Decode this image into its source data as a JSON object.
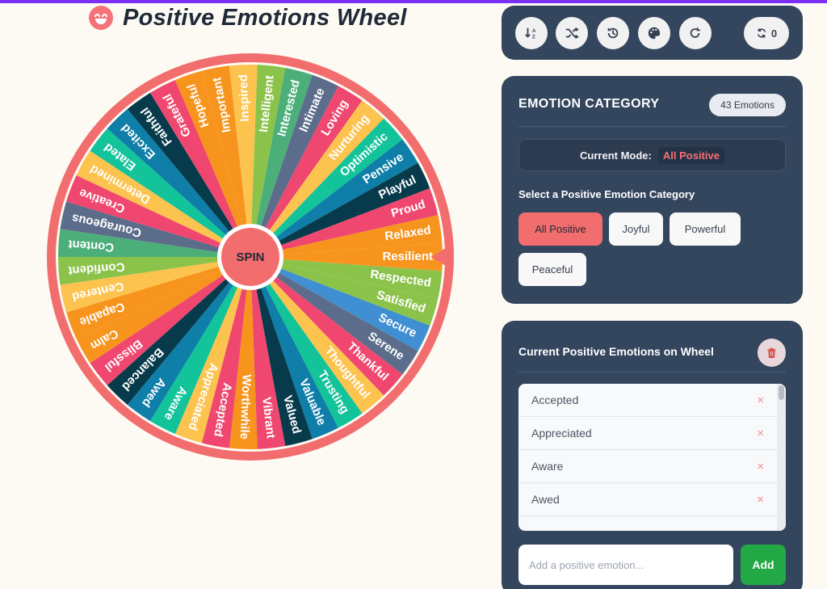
{
  "header": {
    "title": "Positive Emotions Wheel",
    "emoji_icon": "smiley-icon"
  },
  "wheel": {
    "spin_label": "SPIN",
    "rim_color": "#f26d6d",
    "segments": [
      "Resilient",
      "Respected",
      "Satisfied",
      "Secure",
      "Serene",
      "Thankful",
      "Thoughtful",
      "Trusting",
      "Valuable",
      "Valued",
      "Vibrant",
      "Worthwhile",
      "Accepted",
      "Appreciated",
      "Aware",
      "Awed",
      "Balanced",
      "Blissful",
      "Calm",
      "Capable",
      "Centered",
      "Confident",
      "Content",
      "Courageous",
      "Creative",
      "Determined",
      "Elated",
      "Excited",
      "Faithful",
      "Grateful",
      "Hopeful",
      "Important",
      "Inspired",
      "Intelligent",
      "Interested",
      "Intimate",
      "Loving",
      "Nurturing",
      "Optimistic",
      "Pensive",
      "Playful",
      "Proud",
      "Relaxed"
    ],
    "colors": [
      "#f7941d",
      "#8bc34a",
      "#8bc34a",
      "#3f8fd2",
      "#5b6d8a",
      "#ef476f",
      "#fcc34f",
      "#13c39a",
      "#0f7ea8",
      "#073b4c",
      "#ef476f",
      "#f7941d",
      "#ef476f",
      "#fcc34f",
      "#13c39a",
      "#0f7ea8",
      "#073b4c",
      "#ef476f",
      "#f7941d",
      "#f7941d",
      "#fcc34f",
      "#8bc34a",
      "#4caf7a",
      "#5b6d8a",
      "#ef476f",
      "#fcc34f",
      "#13c39a",
      "#0f7ea8",
      "#073b4c",
      "#ef476f",
      "#f7941d",
      "#f7941d",
      "#fcc34f",
      "#8bc34a",
      "#4caf7a",
      "#5b6d8a",
      "#ef476f",
      "#fcc34f",
      "#13c39a",
      "#0f7ea8",
      "#073b4c",
      "#ef476f",
      "#f7941d"
    ]
  },
  "toolbar": {
    "sort_icon": "sort-az-icon",
    "shuffle_icon": "shuffle-icon",
    "history_icon": "history-icon",
    "palette_icon": "palette-icon",
    "redo_icon": "redo-icon",
    "spin_count": "0"
  },
  "category": {
    "title": "EMOTION CATEGORY",
    "badge": "43 Emotions",
    "mode_label": "Current Mode:",
    "mode_value": "All Positive",
    "select_label": "Select a Positive Emotion Category",
    "chips": [
      "All Positive",
      "Joyful",
      "Powerful",
      "Peaceful"
    ]
  },
  "list": {
    "title": "Current Positive Emotions on Wheel",
    "items": [
      "Accepted",
      "Appreciated",
      "Aware",
      "Awed"
    ],
    "remove_symbol": "×",
    "input_placeholder": "Add a positive emotion...",
    "add_label": "Add"
  }
}
